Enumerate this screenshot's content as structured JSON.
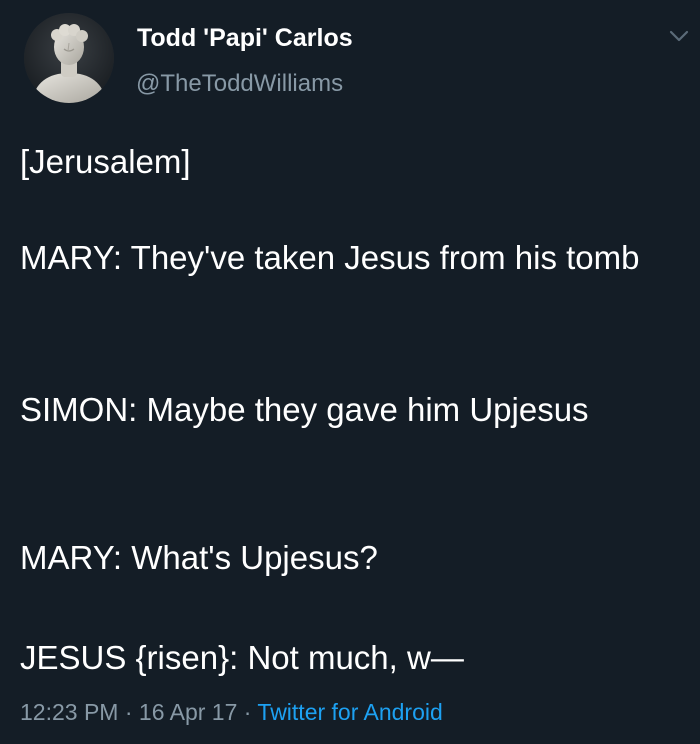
{
  "tweet": {
    "author": {
      "display_name": "Todd 'Papi' Carlos",
      "handle": "@TheToddWilliams",
      "avatar_icon": "statue-bust-avatar"
    },
    "menu_icon": "chevron-down-icon",
    "lines": [
      "[Jerusalem]",
      "MARY: They've taken Jesus from his tomb",
      "SIMON: Maybe they gave him Upjesus",
      "MARY: What's Upjesus?",
      "JESUS {risen}: Not much, w—"
    ],
    "time": "12:23 PM",
    "separator": "·",
    "date": "16 Apr 17",
    "source": "Twitter for Android"
  },
  "colors": {
    "background": "#141d26",
    "text_primary": "#ffffff",
    "text_secondary": "#8899a6",
    "link": "#1da1f2"
  }
}
